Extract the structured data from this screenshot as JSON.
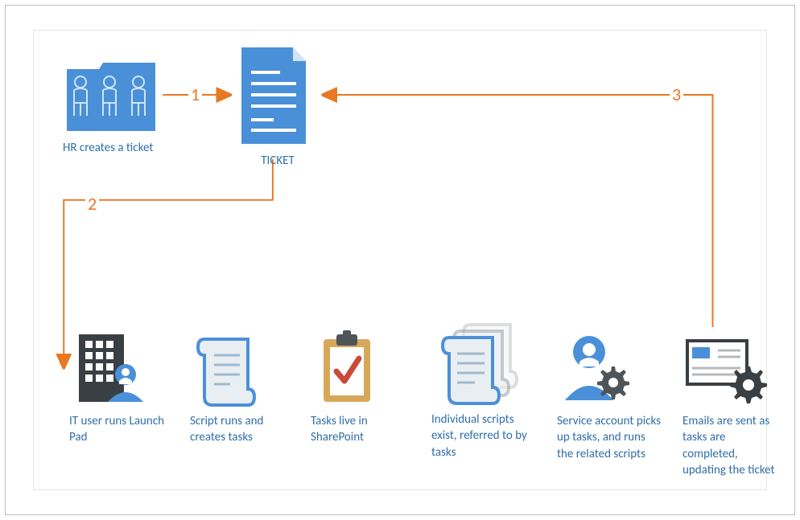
{
  "nodes": {
    "hr": {
      "label": "HR creates a ticket"
    },
    "ticket": {
      "label": "TICKET"
    },
    "it_user": {
      "label": "IT user runs Launch Pad"
    },
    "script_runs": {
      "label": "Script runs and creates tasks"
    },
    "tasks_sharepoint": {
      "label": "Tasks live in SharePoint"
    },
    "individual_scripts": {
      "label": "Individual scripts exist, referred to by tasks"
    },
    "service_account": {
      "label": "Service account picks up tasks, and runs the related scripts"
    },
    "emails": {
      "label": "Emails are sent as tasks are completed, updating the ticket"
    }
  },
  "arrows": {
    "a1": "1",
    "a2": "2",
    "a3": "3"
  },
  "colors": {
    "accent_blue": "#4a90d9",
    "accent_orange": "#e87823",
    "label_blue": "#2f6fa8",
    "grey": "#b8b8b8",
    "dark": "#3a3f44"
  }
}
